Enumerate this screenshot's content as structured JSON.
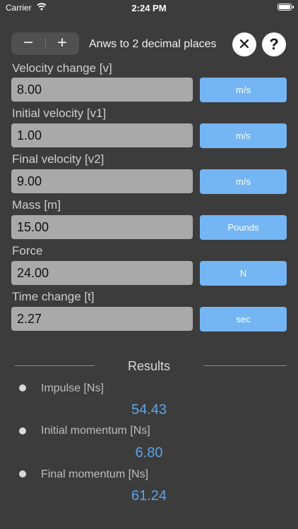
{
  "status": {
    "carrier": "Carrier",
    "time": "2:24 PM"
  },
  "toolbar": {
    "minus": "−",
    "plus": "+",
    "precision_label": "Anws to 2 decimal places",
    "clear": "✕",
    "help": "?"
  },
  "fields": {
    "velocity_change": {
      "label": "Velocity change [v]",
      "value": "8.00",
      "unit": "m/s"
    },
    "initial_velocity": {
      "label": "Initial velocity [v1]",
      "value": "1.00",
      "unit": "m/s"
    },
    "final_velocity": {
      "label": "Final velocity [v2]",
      "value": "9.00",
      "unit": "m/s"
    },
    "mass": {
      "label": "Mass [m]",
      "value": "15.00",
      "unit": "Pounds"
    },
    "force": {
      "label": "Force",
      "value": "24.00",
      "unit": "N"
    },
    "time_change": {
      "label": "Time change [t]",
      "value": "2.27",
      "unit": "sec"
    }
  },
  "results": {
    "title": "Results",
    "impulse": {
      "label": "Impulse [Ns]",
      "value": "54.43"
    },
    "initial_momentum": {
      "label": "Initial momentum [Ns]",
      "value": "6.80"
    },
    "final_momentum": {
      "label": "Final momentum [Ns]",
      "value": "61.24"
    }
  },
  "colors": {
    "background": "#3c3c3c",
    "accent": "#74b5f3",
    "result_value": "#5ea3e8",
    "input": "#a9a9a9"
  }
}
